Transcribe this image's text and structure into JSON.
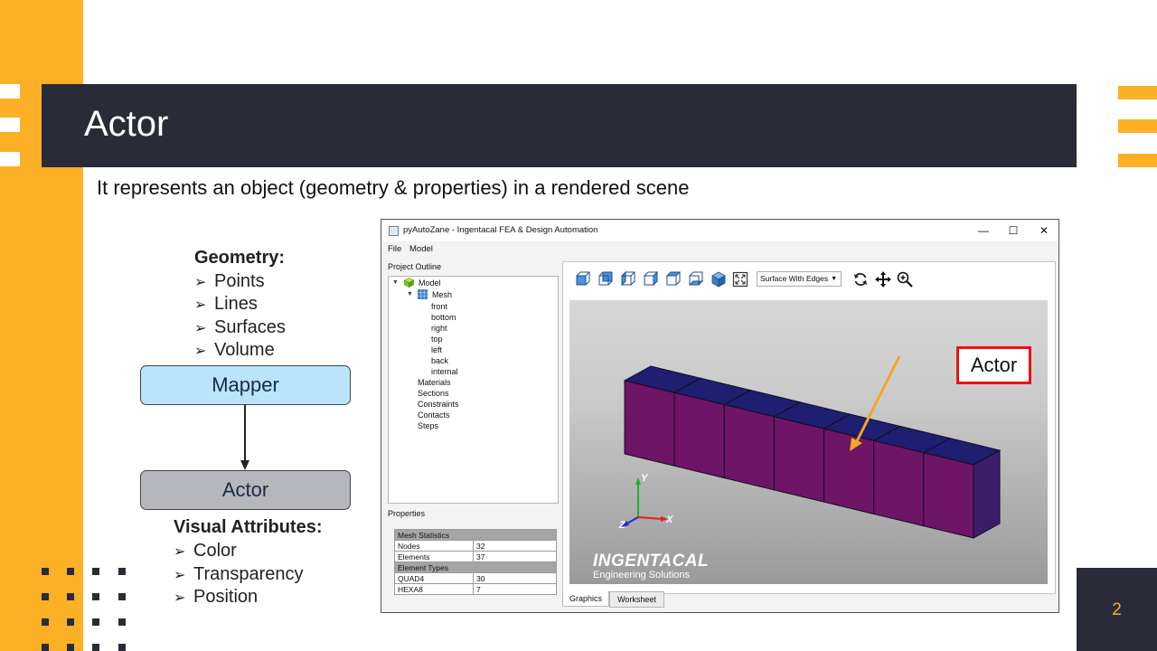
{
  "slide": {
    "title": "Actor",
    "subtitle": "It represents an object (geometry & properties) in a rendered scene",
    "page_number": "2"
  },
  "diagram": {
    "geometry_heading": "Geometry:",
    "geometry_items": [
      "Points",
      "Lines",
      "Surfaces",
      "Volume"
    ],
    "mapper_label": "Mapper",
    "actor_label": "Actor",
    "visual_heading": "Visual Attributes:",
    "visual_items": [
      "Color",
      "Transparency",
      "Position"
    ],
    "bullet_glyph": "➢"
  },
  "app": {
    "window_title": "pyAutoZane - Ingentacal FEA & Design Automation",
    "window_controls": {
      "minimize": "—",
      "maximize": "☐",
      "close": "✕"
    },
    "menu": [
      "File",
      "Model"
    ],
    "outline_label": "Project Outline",
    "tree": {
      "model": "Model",
      "mesh": "Mesh",
      "surfaces": [
        "front",
        "bottom",
        "right",
        "top",
        "left",
        "back",
        "internal"
      ],
      "categories": [
        "Materials",
        "Sections",
        "Constraints",
        "Contacts",
        "Steps"
      ]
    },
    "properties_label": "Properties",
    "properties": {
      "mesh_statistics_header": "Mesh Statistics",
      "rows_stats": [
        {
          "key": "Nodes",
          "value": "32"
        },
        {
          "key": "Elements",
          "value": "37"
        }
      ],
      "element_types_header": "Element Types",
      "rows_types": [
        {
          "key": "QUAD4",
          "value": "30"
        },
        {
          "key": "HEXA8",
          "value": "7"
        }
      ]
    },
    "toolbar": {
      "view_icons": [
        "view-front-icon",
        "view-back-icon",
        "view-left-icon",
        "view-right-icon",
        "view-top-icon",
        "view-bottom-icon",
        "view-iso-icon"
      ],
      "render_mode": "Surface With Edges",
      "tool_icons": [
        "rotate-icon",
        "pan-icon",
        "zoom-icon"
      ]
    },
    "viewport": {
      "axis_labels": {
        "x": "X",
        "y": "Y",
        "z": "Z"
      },
      "logo_main": "INGENTACAL",
      "logo_sub": "Engineering Solutions",
      "callout": "Actor",
      "colors": {
        "beam_side": "#6e1566",
        "beam_top": "#1e1f70",
        "beam_end": "#3a1d6a",
        "callout_arrow": "#f5a623",
        "callout_border": "#e11111"
      }
    },
    "tabs": [
      "Graphics",
      "Worksheet"
    ]
  },
  "theme": {
    "accent": "#fbb026",
    "dark": "#2a2b38"
  }
}
